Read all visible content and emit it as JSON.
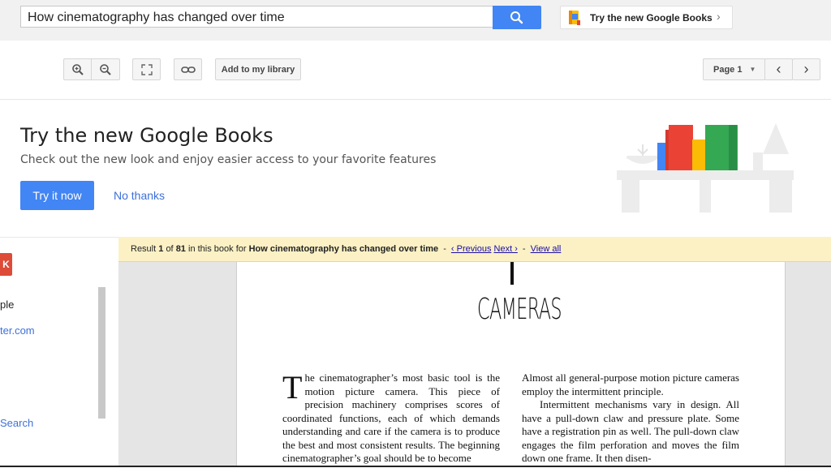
{
  "search": {
    "query": "How cinematography has changed over time"
  },
  "try_new_books": {
    "label": "Try the new Google Books"
  },
  "toolbar": {
    "add_library_label": "Add to my library",
    "page_label": "Page 1"
  },
  "promo": {
    "title": "Try the new Google Books",
    "subtitle": "Check out the new look and enjoy easier access to your favorite features",
    "try_label": "Try it now",
    "no_thanks_label": "No thanks"
  },
  "sidebar": {
    "badge": "K",
    "text1": "ple",
    "link1": "ter.com",
    "link2": "Search"
  },
  "result_bar": {
    "prefix": "Result",
    "index": "1",
    "of": "of",
    "total": "81",
    "mid": "in this book for",
    "query": "How cinematography has changed over time",
    "sep1": "-",
    "prev": "‹ Previous",
    "next": "Next ›",
    "sep2": "-",
    "view_all": "View all"
  },
  "book": {
    "chapter_title": "CAMERAS",
    "col1_dropcap": "T",
    "col1_text": "he cinematographer’s most basic tool is the motion picture camera. This piece of precision machinery comprises scores of coordinated functions, each of which demands understanding and care if the camera is to produce the best and most consistent results. The beginning cinematographer’s goal should be to become",
    "col2_p1": "Almost all general-purpose motion picture cameras employ the intermittent principle.",
    "col2_p2": "Intermittent mechanisms vary in design. All have a pull-down claw and pressure plate. Some have a registration pin as well. The pull-down claw engages the film perforation and moves the film down one frame. It then disen-"
  },
  "colors": {
    "accent": "#4285f4",
    "result_bg": "#fbf1c5",
    "link": "#1a0dab"
  }
}
